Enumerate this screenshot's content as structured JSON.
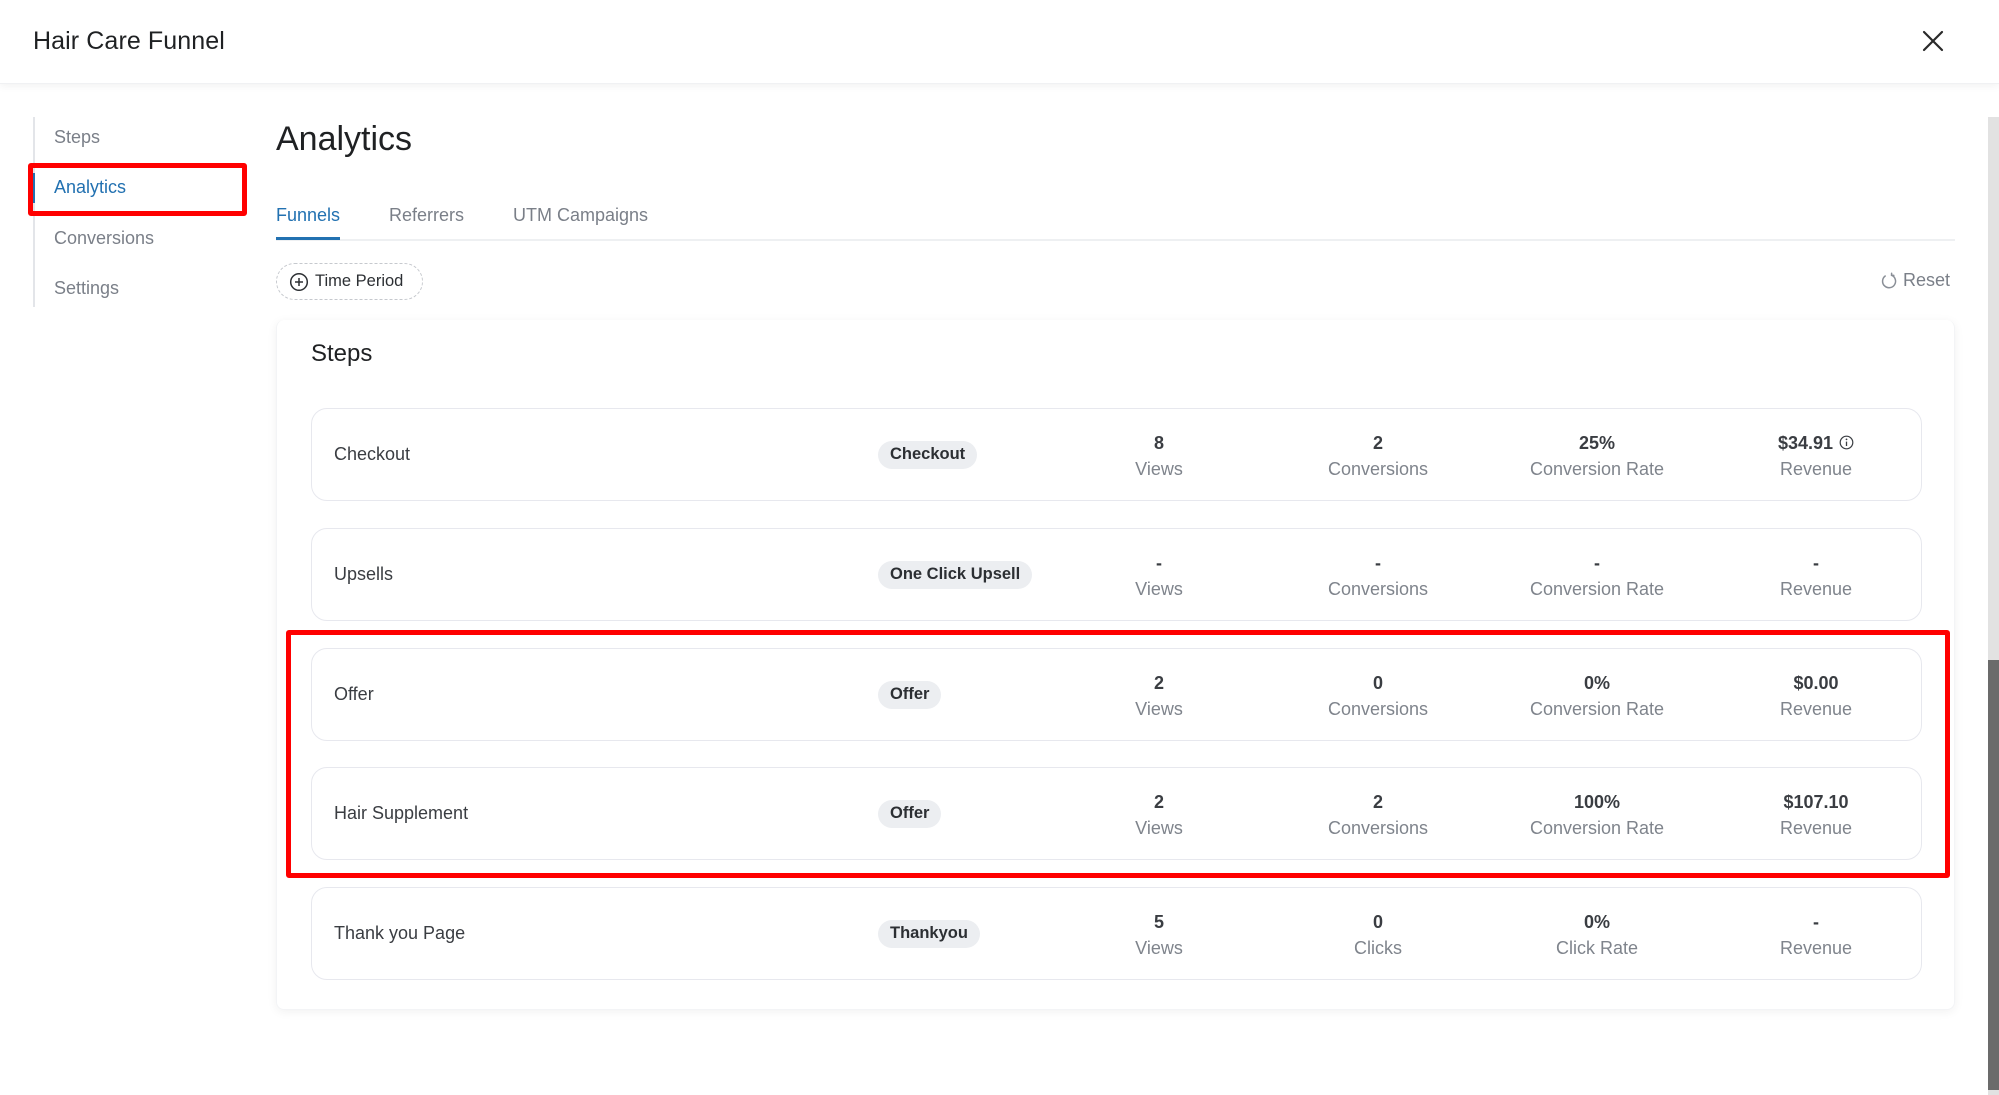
{
  "header": {
    "title": "Hair Care Funnel",
    "close_icon": "close-icon"
  },
  "sidebar": {
    "items": [
      {
        "label": "Steps",
        "active": false
      },
      {
        "label": "Analytics",
        "active": true
      },
      {
        "label": "Conversions",
        "active": false
      },
      {
        "label": "Settings",
        "active": false
      }
    ]
  },
  "main": {
    "title": "Analytics",
    "tabs": [
      {
        "label": "Funnels",
        "active": true
      },
      {
        "label": "Referrers",
        "active": false
      },
      {
        "label": "UTM Campaigns",
        "active": false
      }
    ],
    "filter": {
      "label": "Time Period",
      "icon": "plus-circle-icon"
    },
    "reset": {
      "label": "Reset",
      "icon": "refresh-icon"
    }
  },
  "steps": {
    "title": "Steps",
    "rows": [
      {
        "name": "Checkout",
        "tag": "Checkout",
        "metrics": [
          {
            "value": "8",
            "label": "Views"
          },
          {
            "value": "2",
            "label": "Conversions"
          },
          {
            "value": "25%",
            "label": "Conversion Rate"
          },
          {
            "value": "$34.91",
            "label": "Revenue",
            "info": true
          }
        ]
      },
      {
        "name": "Upsells",
        "tag": "One Click Upsell",
        "metrics": [
          {
            "value": "-",
            "label": "Views"
          },
          {
            "value": "-",
            "label": "Conversions"
          },
          {
            "value": "-",
            "label": "Conversion Rate"
          },
          {
            "value": "-",
            "label": "Revenue"
          }
        ]
      },
      {
        "name": "Offer",
        "tag": "Offer",
        "metrics": [
          {
            "value": "2",
            "label": "Views"
          },
          {
            "value": "0",
            "label": "Conversions"
          },
          {
            "value": "0%",
            "label": "Conversion Rate"
          },
          {
            "value": "$0.00",
            "label": "Revenue"
          }
        ]
      },
      {
        "name": "Hair Supplement",
        "tag": "Offer",
        "metrics": [
          {
            "value": "2",
            "label": "Views"
          },
          {
            "value": "2",
            "label": "Conversions"
          },
          {
            "value": "100%",
            "label": "Conversion Rate"
          },
          {
            "value": "$107.10",
            "label": "Revenue"
          }
        ]
      },
      {
        "name": "Thank you Page",
        "tag": "Thankyou",
        "metrics": [
          {
            "value": "5",
            "label": "Views"
          },
          {
            "value": "0",
            "label": "Clicks"
          },
          {
            "value": "0%",
            "label": "Click Rate"
          },
          {
            "value": "-",
            "label": "Revenue"
          }
        ]
      }
    ]
  },
  "colors": {
    "accent": "#2271b1",
    "highlight": "#ff0000",
    "muted_text": "#7a7f88",
    "tag_bg": "#eceef1"
  }
}
